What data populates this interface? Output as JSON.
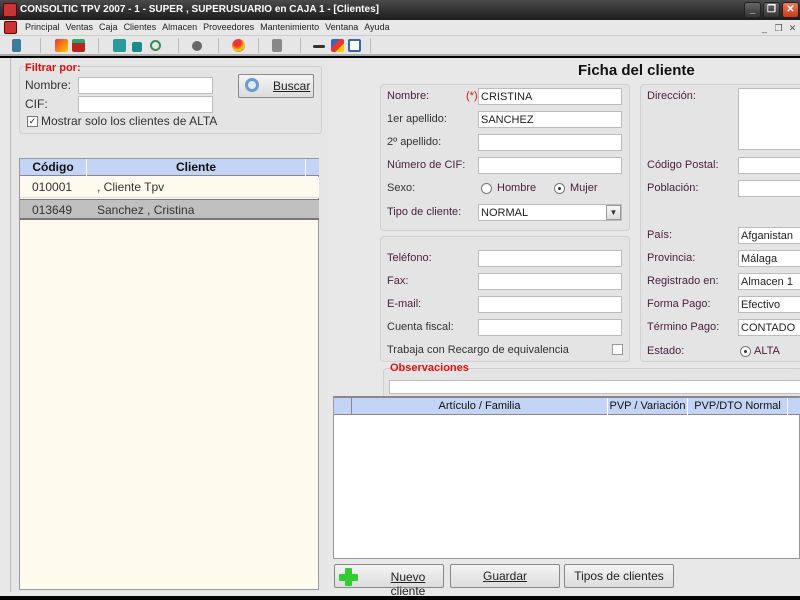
{
  "window": {
    "title": "CONSOLTIC TPV 2007 - 1 - SUPER , SUPERUSUARIO  en CAJA 1 - [Clientes]",
    "controls": {
      "minimize": "_",
      "restore": "❐",
      "close": "✕"
    }
  },
  "menubar": {
    "items": [
      "Principal",
      "Ventas",
      "Caja",
      "Clientes",
      "Almacen",
      "Proveedores",
      "Mantenimiento",
      "Ventana",
      "Ayuda"
    ],
    "mdi_controls": {
      "minimize": "_",
      "restore": "❐",
      "close": "✕"
    }
  },
  "toolbar": {
    "icons": [
      "exit-door-icon",
      "flash-icon",
      "cash-register-icon",
      "cashbox-icon",
      "box-icon",
      "refresh-icon",
      "spy-icon",
      "colors-icon",
      "building-icon",
      "key-icon",
      "shapes-icon",
      "edit-icon"
    ]
  },
  "filter": {
    "legend": "Filtrar por:",
    "nombre_label": "Nombre:",
    "nombre_value": "",
    "cif_label": "CIF:",
    "cif_value": "",
    "alta_checkbox_label": "Mostrar solo los clientes de ALTA",
    "alta_checked": true,
    "search_button": "Buscar"
  },
  "client_list": {
    "columns": [
      "Código",
      "Cliente"
    ],
    "rows": [
      {
        "codigo": "010001",
        "cliente": ", Cliente Tpv",
        "selected": false
      },
      {
        "codigo": "013649",
        "cliente": "Sanchez , Cristina",
        "selected": true
      }
    ]
  },
  "detail": {
    "title": "Ficha del cliente",
    "required_marker": "(*)",
    "nombre": {
      "label": "Nombre:",
      "value": "CRISTINA"
    },
    "apellido1": {
      "label": "1er apellido:",
      "value": "SANCHEZ"
    },
    "apellido2": {
      "label": "2º apellido:",
      "value": ""
    },
    "cif": {
      "label": "Número de CIF:",
      "value": ""
    },
    "sexo": {
      "label": "Sexo:",
      "options": [
        "Hombre",
        "Mujer"
      ],
      "selected": "Mujer"
    },
    "tipo": {
      "label": "Tipo de cliente:",
      "value": "NORMAL"
    },
    "telefono": {
      "label": "Teléfono:",
      "value": ""
    },
    "fax": {
      "label": "Fax:",
      "value": ""
    },
    "email": {
      "label": "E-mail:",
      "value": ""
    },
    "cuenta_fiscal": {
      "label": "Cuenta fiscal:",
      "value": ""
    },
    "recargo": {
      "label": "Trabaja con Recargo de equivalencia",
      "checked": false
    },
    "direccion": {
      "label": "Dirección:",
      "value": ""
    },
    "codigo_postal": {
      "label": "Código Postal:",
      "value": ""
    },
    "poblacion": {
      "label": "Población:",
      "value": ""
    },
    "pais": {
      "label": "País:",
      "value": "Afganistan"
    },
    "provincia": {
      "label": "Provincia:",
      "value": "Málaga"
    },
    "registrado": {
      "label": "Registrado en:",
      "value": "Almacen 1"
    },
    "forma_pago": {
      "label": "Forma Pago:",
      "value": "Efectivo"
    },
    "termino_pago": {
      "label": "Término Pago:",
      "value": "CONTADO"
    },
    "estado": {
      "label": "Estado:",
      "value": "ALTA"
    },
    "observaciones": {
      "label": "Observaciones",
      "value": ""
    }
  },
  "articles_grid": {
    "columns": [
      "Artículo / Familia",
      "PVP / Variación",
      "PVP/DTO Normal"
    ]
  },
  "actions": {
    "new_client": "Nuevo cliente",
    "save": "Guardar",
    "client_types": "Tipos de clientes"
  }
}
